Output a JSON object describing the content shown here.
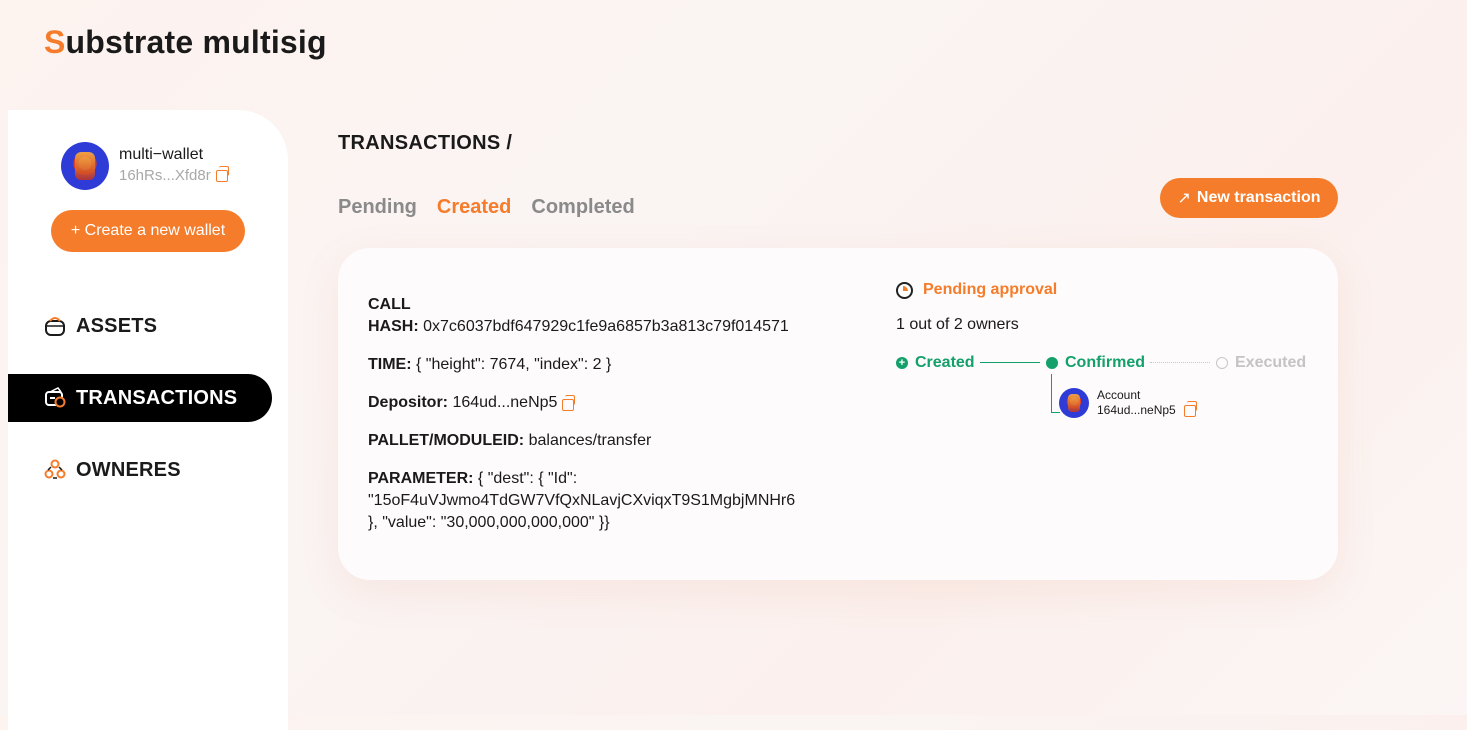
{
  "app": {
    "title_first": "S",
    "title_rest": "ubstrate multisig"
  },
  "sidebar": {
    "wallet": {
      "name": "multi−wallet",
      "address": "16hRs...Xfd8r"
    },
    "create_wallet_label": "+ Create a new wallet",
    "nav": [
      {
        "label": "ASSETS",
        "icon": "assets-icon"
      },
      {
        "label": "TRANSACTIONS",
        "icon": "transactions-icon",
        "active": true
      },
      {
        "label": "OWNERES",
        "icon": "owners-icon"
      }
    ]
  },
  "main": {
    "breadcrumb": "TRANSACTIONS /",
    "tabs": [
      {
        "label": "Pending"
      },
      {
        "label": "Created",
        "active": true
      },
      {
        "label": "Completed"
      }
    ],
    "new_transaction_label": "New transaction",
    "transaction": {
      "call_label": "CALL",
      "hash_label": "HASH:",
      "hash_value": " 0x7c6037bdf647929c1fe9a6857b3a813c79f014571",
      "time_label": "TIME:",
      "time_value": " { \"height\": 7674, \"index\": 2 }",
      "depositor_label": "Depositor:",
      "depositor_value": " 164ud...neNp5",
      "pallet_label": "PALLET/MODULEID:",
      "pallet_value": " balances/transfer",
      "parameter_label": "PARAMETER:",
      "parameter_line1": " { \"dest\": { \"Id\":",
      "parameter_line2": "\"15oF4uVJwmo4TdGW7VfQxNLavjCXviqxT9S1MgbjMNHr6",
      "parameter_line3": "}, \"value\": \"30,000,000,000,000\" }}",
      "status": {
        "label": "Pending approval",
        "owners_count": "1 out of 2 owners",
        "steps": [
          "Created",
          "Confirmed",
          "Executed"
        ],
        "approver_label": "Account",
        "approver_address": "164ud...neNp5"
      }
    }
  },
  "colors": {
    "accent": "#f57c2b",
    "success": "#14a06a",
    "muted": "#8a8a8a"
  }
}
